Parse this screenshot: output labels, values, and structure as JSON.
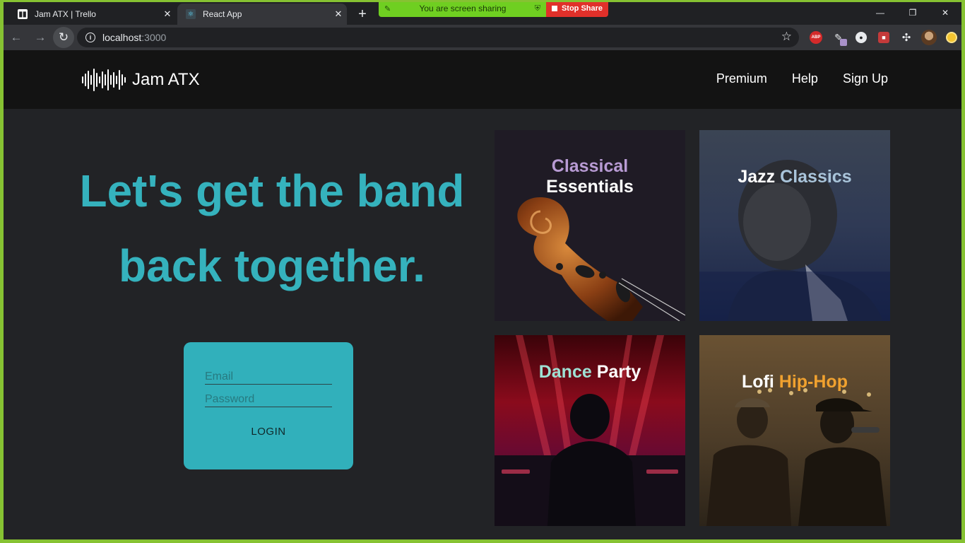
{
  "browser": {
    "tabs": [
      {
        "title": "Jam ATX | Trello",
        "favicon": "trello-icon",
        "active": false
      },
      {
        "title": "React App",
        "favicon": "react-icon",
        "active": true
      }
    ],
    "new_tab_symbol": "+",
    "close_symbol": "✕",
    "screen_share": {
      "message": "You are screen sharing",
      "stop_label": "Stop Share",
      "bar_color": "#6fcf21",
      "stop_color": "#e0302a"
    },
    "window_controls": {
      "minimize": "—",
      "restore": "❐",
      "close": "✕"
    },
    "address_bar": {
      "host": "localhost",
      "port": ":3000"
    },
    "extensions": [
      "adblock-plus-icon",
      "pen-icon",
      "circle-extension-icon",
      "red-extension-icon",
      "puzzle-icon",
      "profile-avatar",
      "yellow-dot-icon"
    ],
    "extension_labels": {
      "abp": "ABP",
      "circle": "●",
      "red": "■",
      "puzzle": "✣"
    }
  },
  "site": {
    "brand": "Jam ATX",
    "nav": [
      "Premium",
      "Help",
      "Sign Up"
    ],
    "headline": [
      "Let's get the band",
      "back together."
    ],
    "accent_color": "#35b2bd",
    "login": {
      "email_placeholder": "Email",
      "password_placeholder": "Password",
      "button_label": "LOGIN"
    },
    "playlists": [
      {
        "line1": "Classical",
        "line2": "Essentials"
      },
      {
        "word1": "Jazz",
        "word2": "Classics"
      },
      {
        "word1": "Dance",
        "word2": "Party"
      },
      {
        "word1": "Lofi",
        "word2": "Hip-Hop"
      }
    ]
  }
}
